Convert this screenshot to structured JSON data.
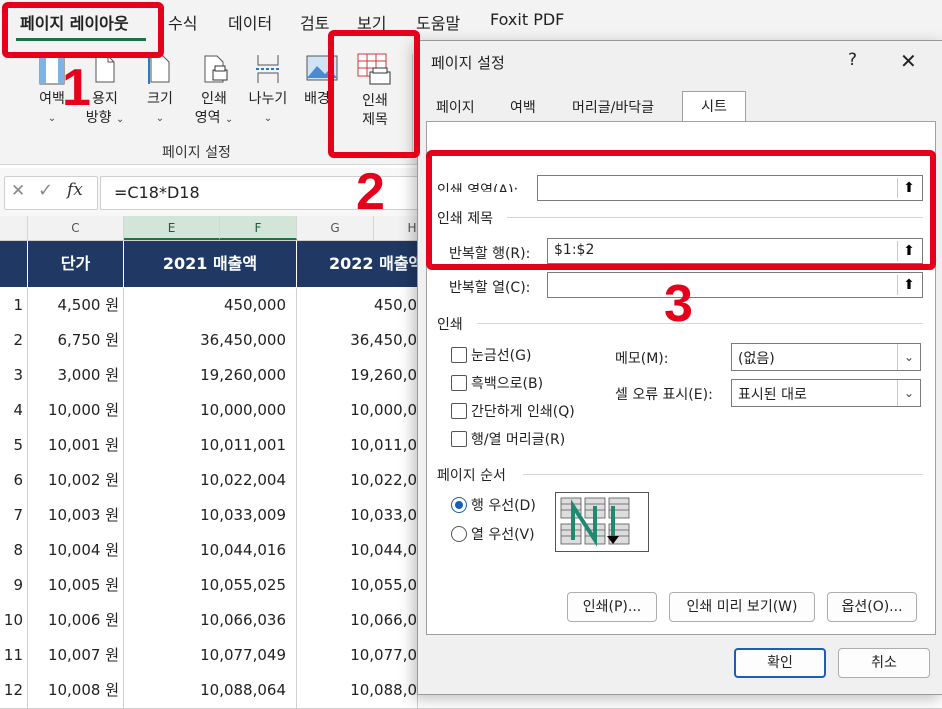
{
  "ribbon_tabs": [
    "페이지 레이아웃",
    "수식",
    "데이터",
    "검토",
    "보기",
    "도움말",
    "Foxit PDF"
  ],
  "ribbon": {
    "buttons": [
      {
        "label": "여백",
        "chevron": "⌄"
      },
      {
        "label": "용지",
        "label2": "방향",
        "chevron": "⌄"
      },
      {
        "label": "크기",
        "chevron": "⌄"
      },
      {
        "label": "인쇄",
        "label2": "영역",
        "chevron": "⌄"
      },
      {
        "label": "나누기",
        "chevron": "⌄"
      },
      {
        "label": "배경"
      },
      {
        "label": "인쇄",
        "label2": "제목"
      }
    ],
    "group_label": "페이지 설정"
  },
  "formula_bar": {
    "cancel_icon": "✕",
    "enter_icon": "✓",
    "fx": "fx",
    "formula": "=C18*D18"
  },
  "sheet": {
    "column_letters": [
      "C",
      "E",
      "F",
      "G",
      "H"
    ],
    "headers": [
      "단가",
      "2021 매출액",
      "2022 매출액"
    ],
    "rows": [
      {
        "a": "1",
        "c": "4,500 원",
        "ef": "450,000",
        "gh": "450,0"
      },
      {
        "a": "2",
        "c": "6,750 원",
        "ef": "36,450,000",
        "gh": "36,450,0"
      },
      {
        "a": "3",
        "c": "3,000 원",
        "ef": "19,260,000",
        "gh": "19,260,0"
      },
      {
        "a": "4",
        "c": "10,000 원",
        "ef": "10,000,000",
        "gh": "10,000,0"
      },
      {
        "a": "5",
        "c": "10,001 원",
        "ef": "10,011,001",
        "gh": "10,011,0"
      },
      {
        "a": "6",
        "c": "10,002 원",
        "ef": "10,022,004",
        "gh": "10,022,0"
      },
      {
        "a": "7",
        "c": "10,003 원",
        "ef": "10,033,009",
        "gh": "10,033,0"
      },
      {
        "a": "8",
        "c": "10,004 원",
        "ef": "10,044,016",
        "gh": "10,044,0"
      },
      {
        "a": "9",
        "c": "10,005 원",
        "ef": "10,055,025",
        "gh": "10,055,0"
      },
      {
        "a": "10",
        "c": "10,006 원",
        "ef": "10,066,036",
        "gh": "10,066,0"
      },
      {
        "a": "11",
        "c": "10,007 원",
        "ef": "10,077,049",
        "gh": "10,077,0"
      },
      {
        "a": "12",
        "c": "10,008 원",
        "ef": "10,088,064",
        "gh": "10,088,0"
      }
    ]
  },
  "dialog": {
    "title": "페이지 설정",
    "help": "?",
    "close": "✕",
    "tabs": [
      "페이지",
      "여백",
      "머리글/바닥글",
      "시트"
    ],
    "active_tab": "시트",
    "print_area_label": "인쇄 영역(A):",
    "print_area_value": "",
    "print_titles_section": "인쇄 제목",
    "rows_to_repeat_label": "반복할 행(R):",
    "rows_to_repeat_value": "$1:$2",
    "cols_to_repeat_label": "반복할 열(C):",
    "cols_to_repeat_value": "",
    "print_section": "인쇄",
    "checkboxes": [
      "눈금선(G)",
      "흑백으로(B)",
      "간단하게 인쇄(Q)",
      "행/열 머리글(R)"
    ],
    "memo_label": "메모(M):",
    "memo_value": "(없음)",
    "cell_errors_label": "셀 오류 표시(E):",
    "cell_errors_value": "표시된 대로",
    "page_order_section": "페이지 순서",
    "page_order_options": [
      "행 우선(D)",
      "열 우선(V)"
    ],
    "page_order_selected": "행 우선(D)",
    "buttons": {
      "print": "인쇄(P)...",
      "preview": "인쇄 미리 보기(W)",
      "options": "옵션(O)..."
    },
    "ok": "확인",
    "cancel": "취소"
  },
  "annotations": {
    "step1": "1",
    "step2": "2",
    "step3": "3",
    "color": "#e5001c"
  },
  "colors": {
    "header_navy": "#1f3864",
    "excel_green": "#1e7145",
    "accent_blue": "#1a5fb4"
  }
}
